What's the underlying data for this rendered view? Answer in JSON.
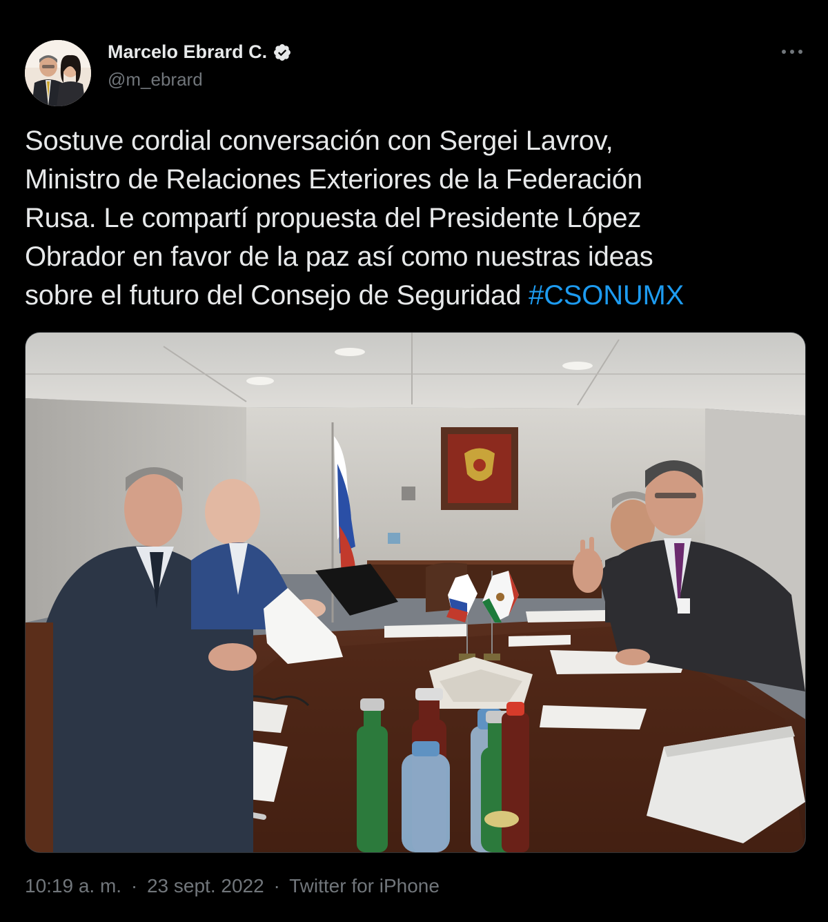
{
  "author": {
    "display_name": "Marcelo Ebrard C.",
    "handle": "@m_ebrard",
    "verified": true
  },
  "tweet": {
    "lines": [
      "Sostuve cordial conversación con Sergei Lavrov,",
      "Ministro de Relaciones Exteriores de la Federación",
      "Rusa. Le compartí propuesta del Presidente López",
      "Obrador en favor de la paz  así como nuestras ideas",
      "sobre el futuro del Consejo de Seguridad "
    ],
    "hashtag": "#CSONUMX"
  },
  "meta": {
    "time": "10:19 a. m.",
    "separator": "·",
    "date": "23 sept. 2022",
    "source": "Twitter for iPhone"
  },
  "icons": {
    "verified": "verified-badge-icon",
    "more": "more-options-icon"
  },
  "colors": {
    "background": "#000000",
    "text": "#e7e9ea",
    "secondary": "#71767b",
    "link": "#1d9bf0"
  }
}
